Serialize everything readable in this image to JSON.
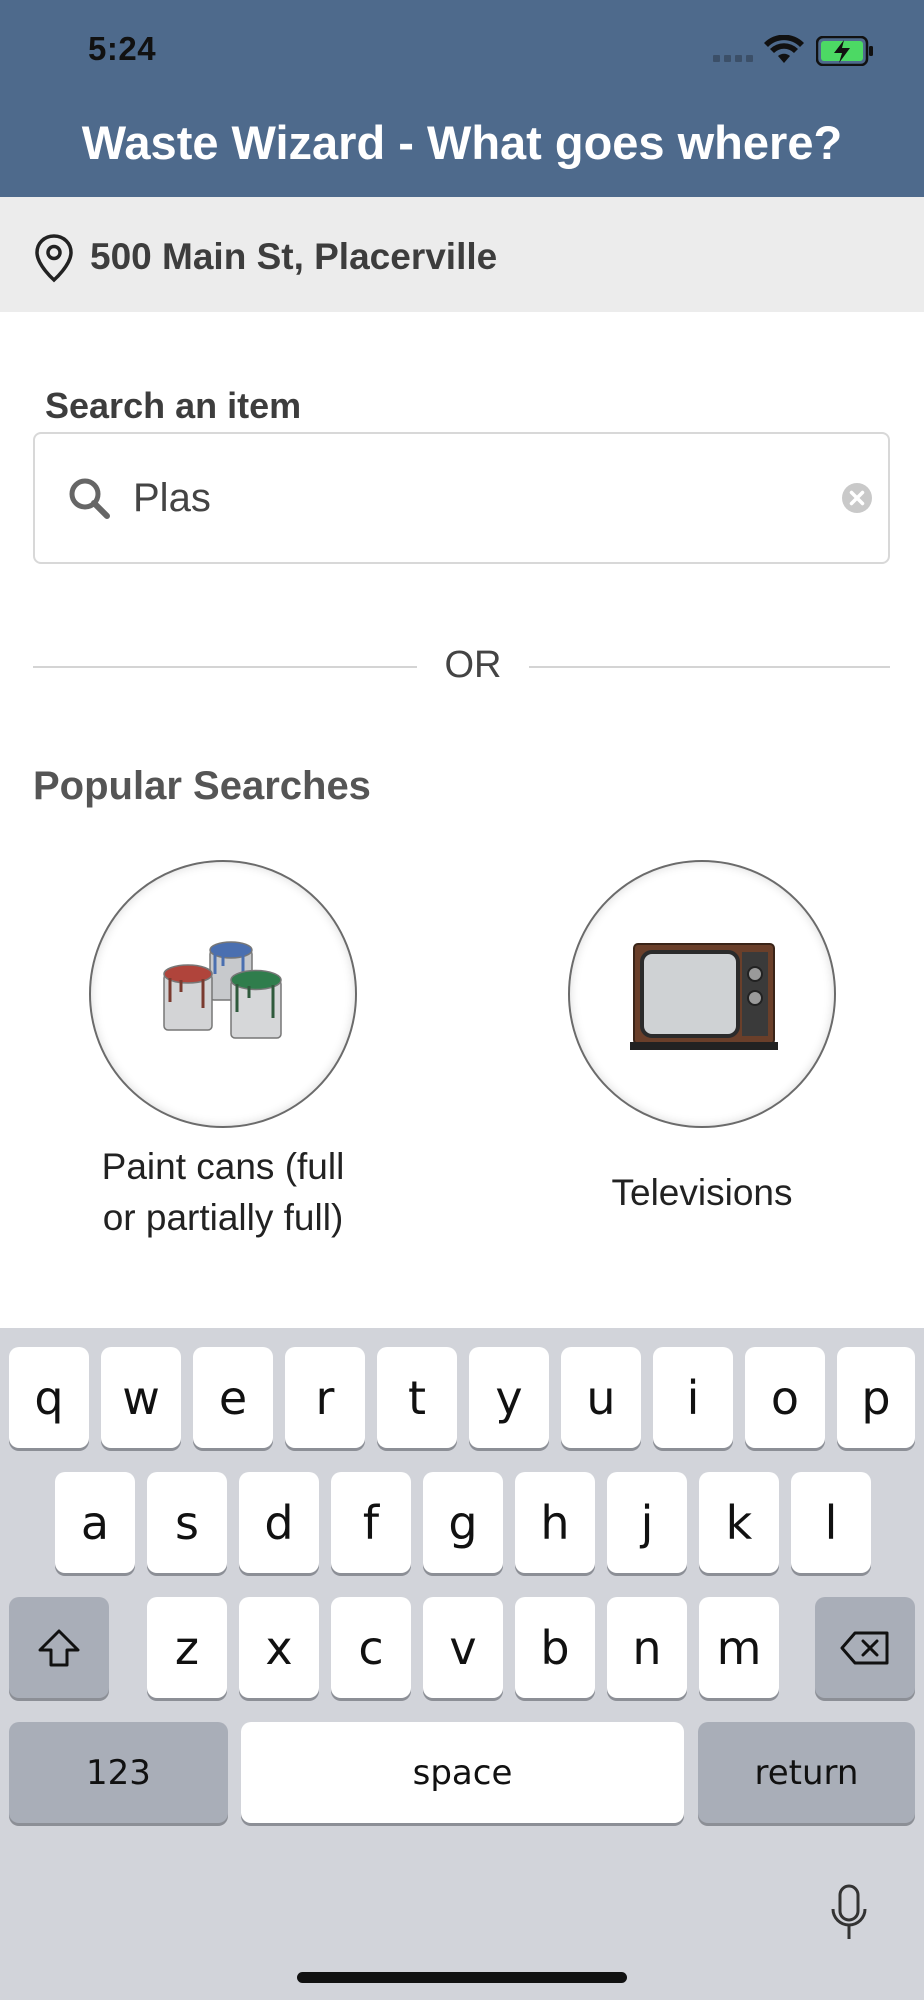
{
  "status_bar": {
    "time": "5:24"
  },
  "header": {
    "title": "Waste Wizard - What goes where?",
    "bg_color": "#4e6a8c"
  },
  "location": {
    "address": "500 Main St, Placerville"
  },
  "search": {
    "label": "Search an item",
    "value": "Plas"
  },
  "divider": {
    "text": "OR"
  },
  "popular": {
    "title": "Popular Searches",
    "items": [
      {
        "caption_line1": "Paint cans (full",
        "caption_line2": "or partially full)",
        "icon": "paint-cans-icon"
      },
      {
        "caption": "Televisions",
        "icon": "television-icon"
      }
    ]
  },
  "keyboard": {
    "row1": [
      "q",
      "w",
      "e",
      "r",
      "t",
      "y",
      "u",
      "i",
      "o",
      "p"
    ],
    "row2": [
      "a",
      "s",
      "d",
      "f",
      "g",
      "h",
      "j",
      "k",
      "l"
    ],
    "row3": [
      "z",
      "x",
      "c",
      "v",
      "b",
      "n",
      "m"
    ],
    "numbers_label": "123",
    "space_label": "space",
    "return_label": "return"
  }
}
